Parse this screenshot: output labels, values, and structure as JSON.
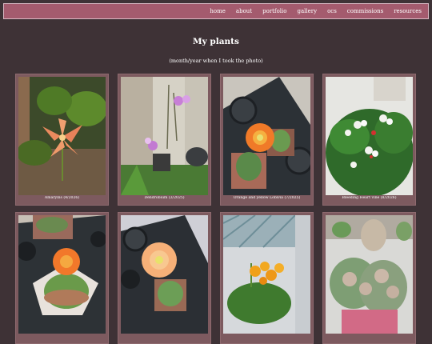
{
  "nav": {
    "links": [
      "home",
      "about",
      "portfolio",
      "gallery",
      "ocs",
      "commissions",
      "resources"
    ]
  },
  "page": {
    "title": "My plants",
    "subtitle": "(month/year when I took the photo)"
  },
  "gallery": {
    "captions": [
      "Amaryllis (4/2026)",
      "Dendrobium (3/2025)",
      "Orange and yellow Lobivia (7/2025)",
      "Bleeding Heart vine (8/2026)",
      "",
      "",
      "",
      ""
    ]
  },
  "colors": {
    "background": "#3e3236",
    "navbar": "#a45b6e",
    "card": "#7d5a5f"
  }
}
